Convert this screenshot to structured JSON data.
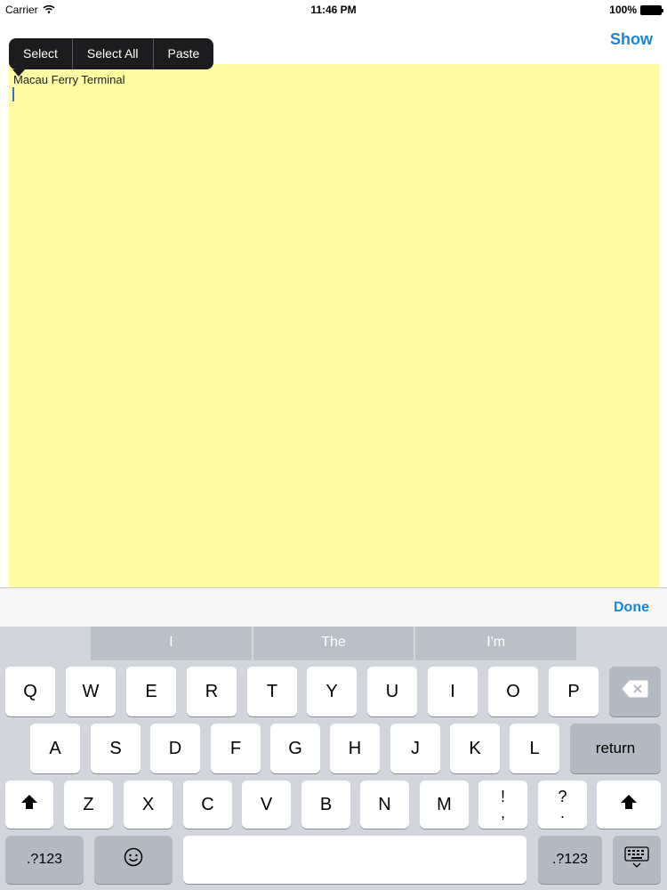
{
  "status_bar": {
    "carrier": "Carrier",
    "time": "11:46 PM",
    "battery": "100%"
  },
  "nav": {
    "show_label": "Show"
  },
  "edit_menu": {
    "select": "Select",
    "select_all": "Select All",
    "paste": "Paste"
  },
  "note": {
    "text": "Macau Ferry Terminal",
    "background": "#fffca1"
  },
  "accessory": {
    "done_label": "Done"
  },
  "keyboard": {
    "suggestions": [
      "I",
      "The",
      "I'm"
    ],
    "row1": [
      "Q",
      "W",
      "E",
      "R",
      "T",
      "Y",
      "U",
      "I",
      "O",
      "P"
    ],
    "row2": [
      "A",
      "S",
      "D",
      "F",
      "G",
      "H",
      "J",
      "K",
      "L"
    ],
    "row3": [
      "Z",
      "X",
      "C",
      "V",
      "B",
      "N",
      "M"
    ],
    "return_label": "return",
    "numbers_label": ".?123",
    "exclam_comma": [
      "!",
      ","
    ],
    "question_period": [
      "?",
      "."
    ]
  },
  "colors": {
    "accent": "#1a85d8",
    "keyboard_bg": "#d2d6dc"
  }
}
